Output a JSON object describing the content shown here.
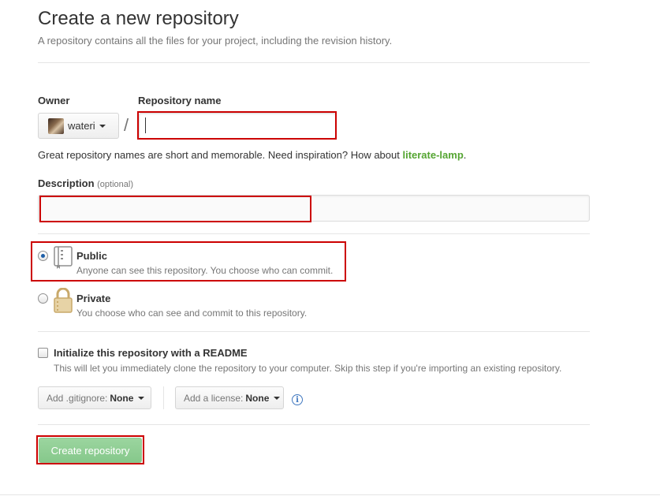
{
  "header": {
    "title": "Create a new repository",
    "subtitle": "A repository contains all the files for your project, including the revision history."
  },
  "owner": {
    "label": "Owner",
    "name": "wateri"
  },
  "separator": "/",
  "repo_name": {
    "label": "Repository name",
    "value": "",
    "hint_prefix": "Great repository names are short and memorable. Need inspiration? How about ",
    "suggestion": "literate-lamp",
    "hint_suffix": "."
  },
  "description": {
    "label": "Description",
    "optional": "(optional)",
    "value": ""
  },
  "visibility": {
    "public": {
      "title": "Public",
      "desc": "Anyone can see this repository. You choose who can commit.",
      "selected": true
    },
    "private": {
      "title": "Private",
      "desc": "You choose who can see and commit to this repository.",
      "selected": false
    }
  },
  "readme": {
    "label": "Initialize this repository with a README",
    "desc": "This will let you immediately clone the repository to your computer. Skip this step if you're importing an existing repository.",
    "checked": false
  },
  "gitignore": {
    "prefix": "Add .gitignore:",
    "value": "None"
  },
  "license": {
    "prefix": "Add a license:",
    "value": "None"
  },
  "info_icon": "i",
  "submit": {
    "label": "Create repository"
  },
  "colors": {
    "highlight": "#cc0000",
    "submit_green": "#8fcf93",
    "suggestion_green": "#55a532",
    "radio_blue": "#1e5fa8"
  }
}
